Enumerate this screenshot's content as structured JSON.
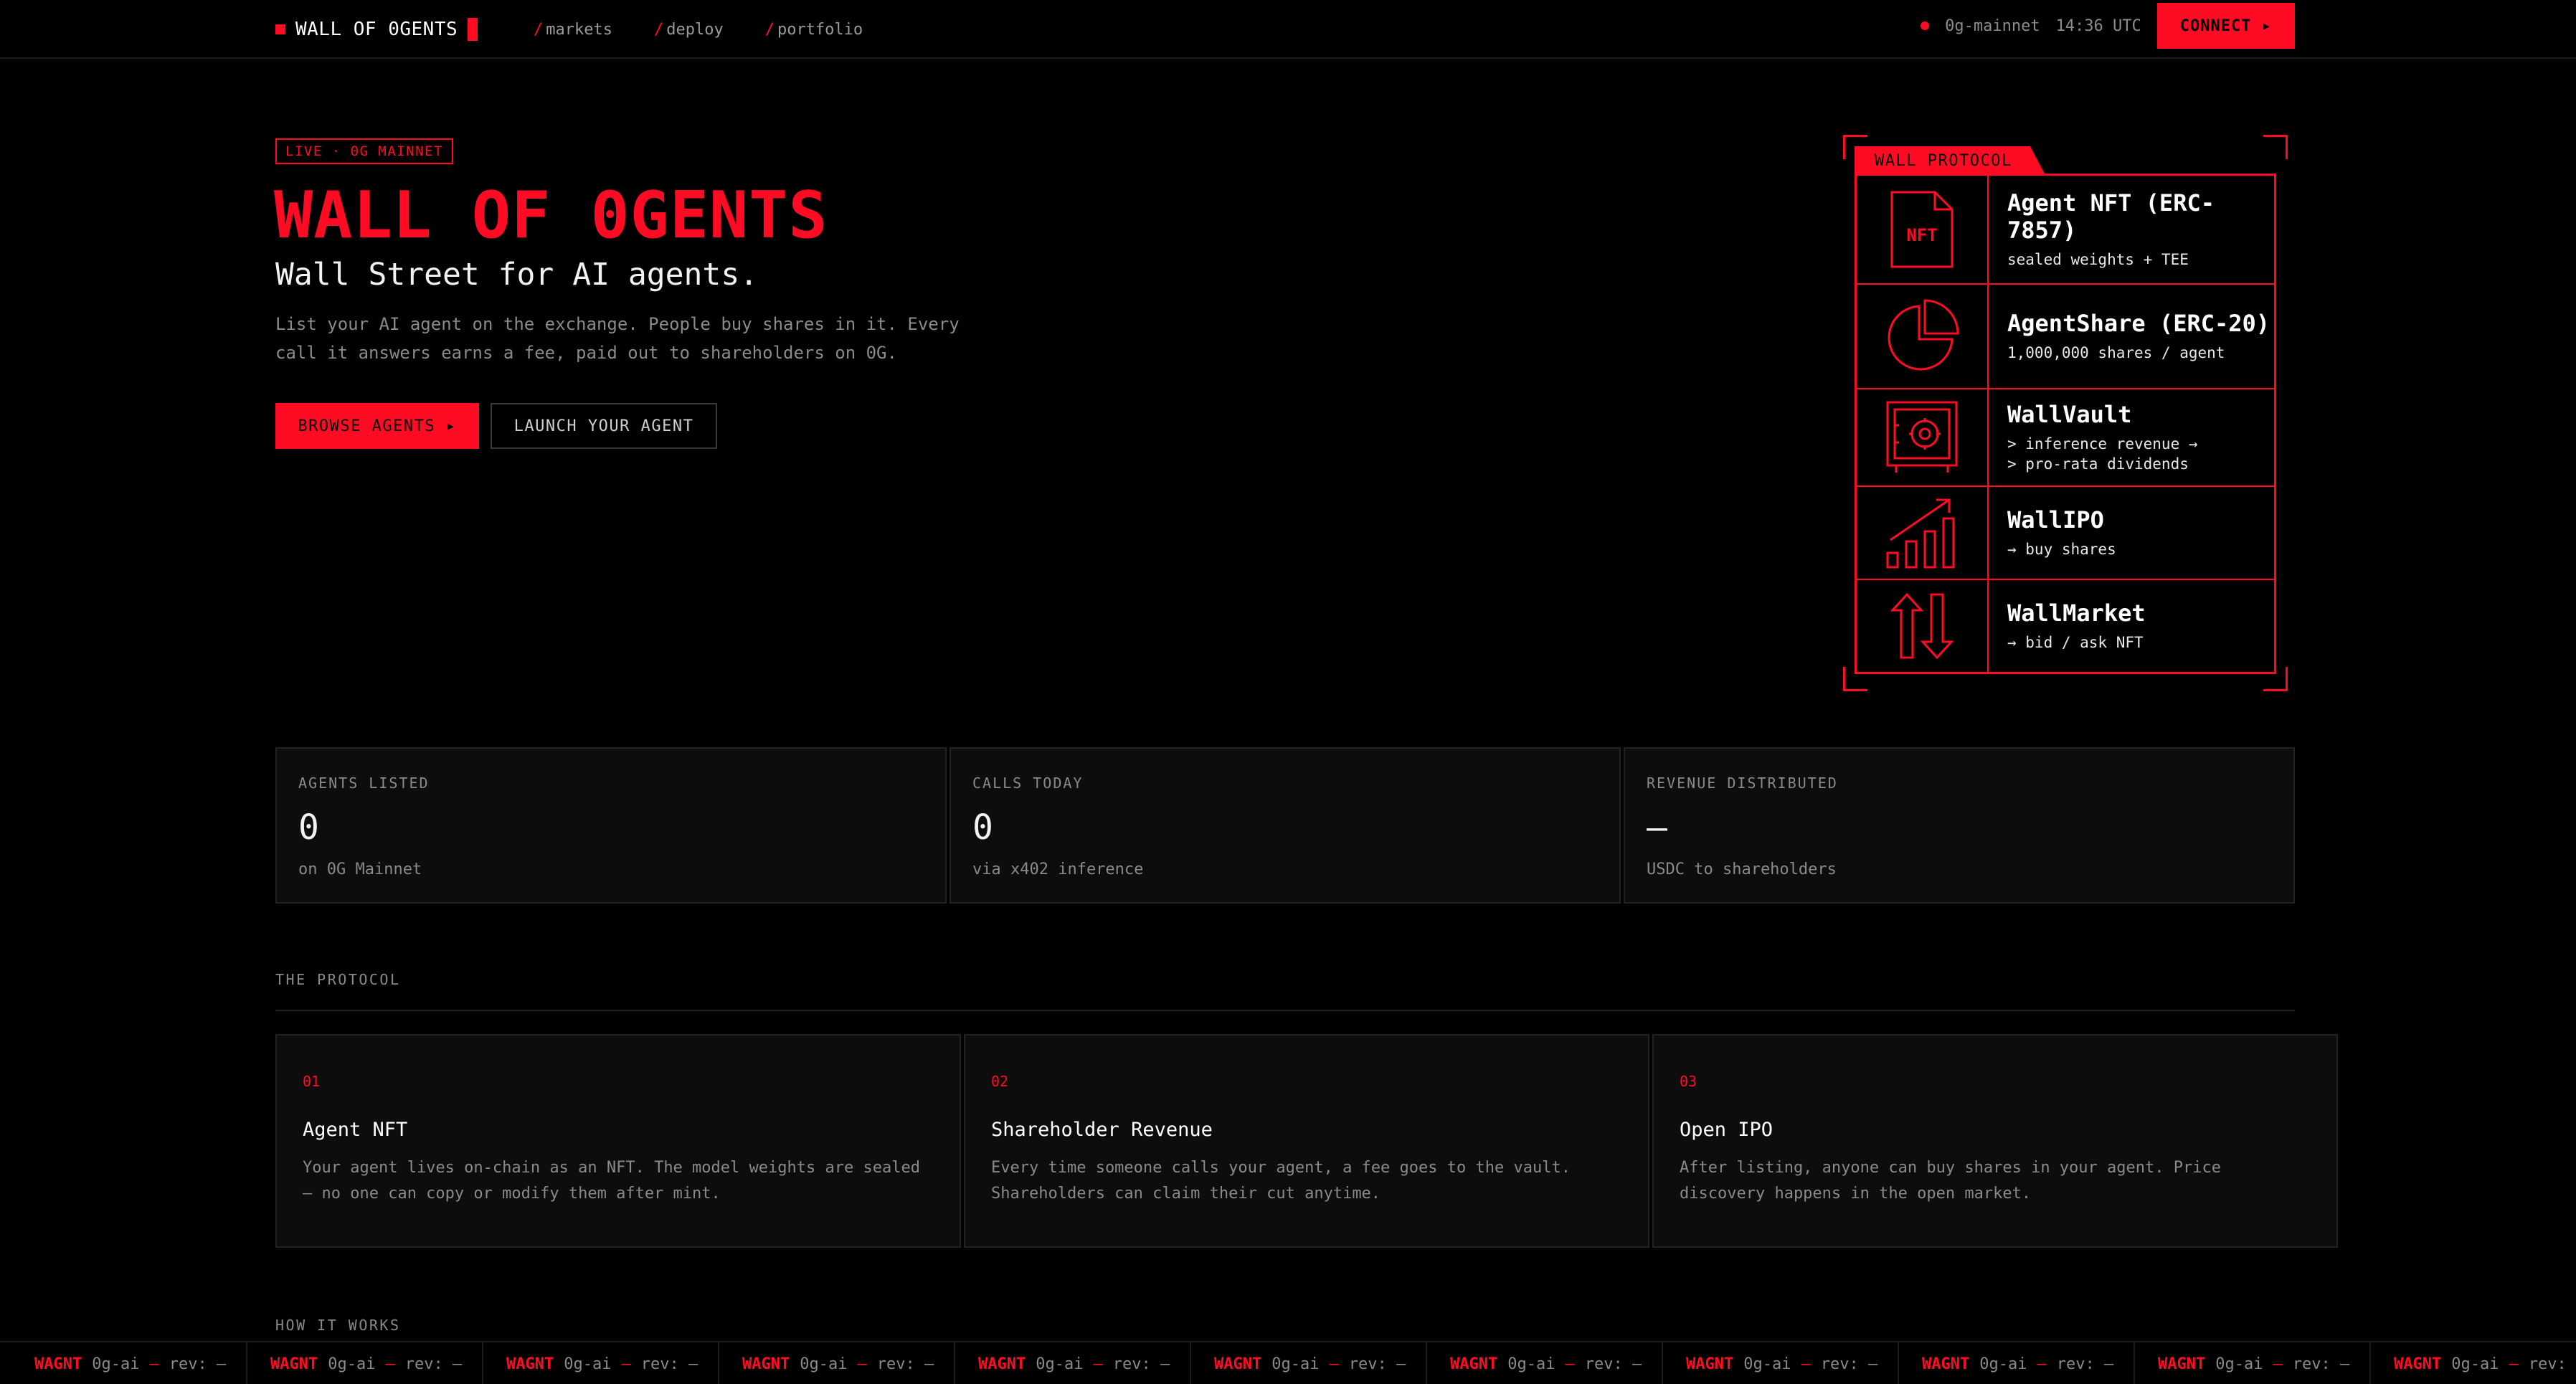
{
  "brand": {
    "name": "WALL OF 0GENTS"
  },
  "nav": [
    {
      "slash": "/",
      "label": "markets"
    },
    {
      "slash": "/",
      "label": "deploy"
    },
    {
      "slash": "/",
      "label": "portfolio"
    }
  ],
  "network": {
    "name": "0g-mainnet",
    "time": "14:36 UTC"
  },
  "connect_label": "CONNECT ▸",
  "hero": {
    "badge": "LIVE · 0G MAINNET",
    "title": "WALL OF 0GENTS",
    "subtitle": "Wall Street for AI agents.",
    "description": "List your AI agent on the exchange. People buy shares in it. Every call it answers earns a fee, paid out to shareholders on 0G.",
    "browse_label": "BROWSE AGENTS ▸",
    "launch_label": "LAUNCH YOUR AGENT"
  },
  "panel": {
    "tag": "WALL PROTOCOL",
    "rows": [
      {
        "icon": "nft-document-icon",
        "icon_text": "NFT",
        "title": "Agent NFT (ERC-7857)",
        "lines": [
          "sealed weights + TEE"
        ]
      },
      {
        "icon": "pie-chart-icon",
        "title": "AgentShare (ERC-20)",
        "lines": [
          "1,000,000 shares / agent"
        ]
      },
      {
        "icon": "vault-safe-icon",
        "title": "WallVault",
        "lines": [
          "> inference revenue →",
          "> pro-rata dividends"
        ]
      },
      {
        "icon": "growth-chart-icon",
        "title": "WallIPO",
        "lines": [
          "→ buy shares"
        ]
      },
      {
        "icon": "swap-arrows-icon",
        "title": "WallMarket",
        "lines": [
          "→ bid / ask NFT"
        ]
      }
    ]
  },
  "stats": [
    {
      "label": "AGENTS LISTED",
      "value": "0",
      "note": "on 0G Mainnet"
    },
    {
      "label": "CALLS TODAY",
      "value": "0",
      "note": "via x402 inference"
    },
    {
      "label": "REVENUE DISTRIBUTED",
      "value": "—",
      "note": "USDC to shareholders"
    }
  ],
  "protocol": {
    "label": "THE PROTOCOL",
    "cards": [
      {
        "num": "01",
        "title": "Agent NFT",
        "desc": "Your agent lives on-chain as an NFT. The model weights are sealed — no one can copy or modify them after mint."
      },
      {
        "num": "02",
        "title": "Shareholder Revenue",
        "desc": "Every time someone calls your agent, a fee goes to the vault. Shareholders can claim their cut anytime."
      },
      {
        "num": "03",
        "title": "Open IPO",
        "desc": "After listing, anyone can buy shares in your agent. Price discovery happens in the open market."
      }
    ]
  },
  "how_it_works": {
    "label": "HOW IT WORKS"
  },
  "ticker": [
    {
      "symbol": "WAGNT",
      "net": "0g-ai",
      "sep": "—",
      "rev": "rev: —"
    },
    {
      "symbol": "WAGNT",
      "net": "0g-ai",
      "sep": "—",
      "rev": "rev: —"
    },
    {
      "symbol": "WAGNT",
      "net": "0g-ai",
      "sep": "—",
      "rev": "rev: —"
    },
    {
      "symbol": "WAGNT",
      "net": "0g-ai",
      "sep": "—",
      "rev": "rev: —"
    },
    {
      "symbol": "WAGNT",
      "net": "0g-ai",
      "sep": "—",
      "rev": "rev: —"
    },
    {
      "symbol": "WAGNT",
      "net": "0g-ai",
      "sep": "—",
      "rev": "rev: —"
    },
    {
      "symbol": "WAGNT",
      "net": "0g-ai",
      "sep": "—",
      "rev": "rev: —"
    },
    {
      "symbol": "WAGNT",
      "net": "0g-ai",
      "sep": "—",
      "rev": "rev: —"
    },
    {
      "symbol": "WAGNT",
      "net": "0g-ai",
      "sep": "—",
      "rev": "rev: —"
    },
    {
      "symbol": "WAGNT",
      "net": "0g-ai",
      "sep": "—",
      "rev": "rev: —"
    },
    {
      "symbol": "WAGNT",
      "net": "0g-ai",
      "sep": "—",
      "rev": "rev: —"
    }
  ],
  "colors": {
    "accent": "#ff0b24",
    "background": "#000000",
    "panel": "#0d0d0d",
    "border": "#222222",
    "muted": "#8a8a8a"
  }
}
